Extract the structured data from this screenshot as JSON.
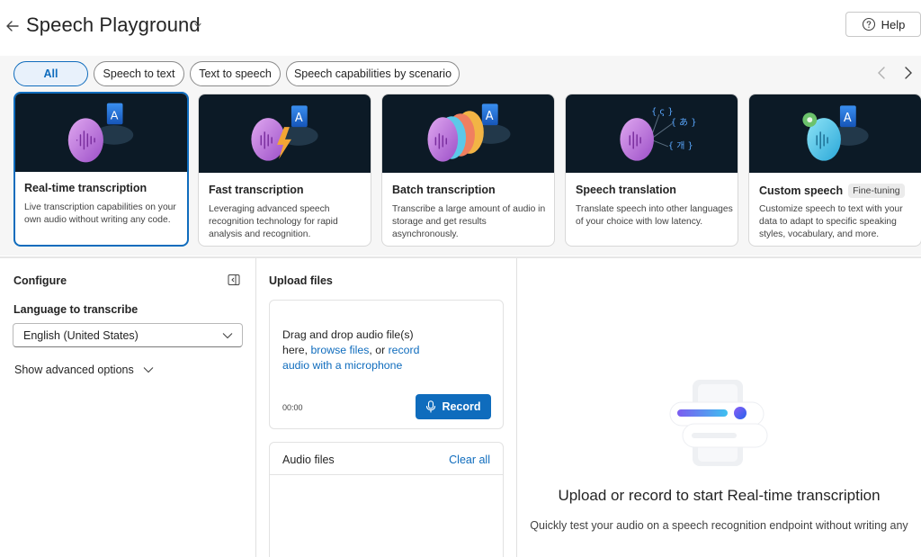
{
  "header": {
    "title": "Speech Playground",
    "help_label": "Help"
  },
  "filters": {
    "items": [
      {
        "label": "All",
        "active": true
      },
      {
        "label": "Speech to text",
        "active": false
      },
      {
        "label": "Text to speech",
        "active": false
      },
      {
        "label": "Speech capabilities by scenario",
        "active": false
      }
    ]
  },
  "cards": [
    {
      "title": "Real-time transcription",
      "desc": "Live transcription capabilities on your own audio without writing any code.",
      "selected": true
    },
    {
      "title": "Fast transcription",
      "desc": "Leveraging advanced speech recognition technology for rapid analysis and recognition.",
      "selected": false
    },
    {
      "title": "Batch transcription",
      "desc": "Transcribe a large amount of audio in storage and get results asynchronously.",
      "selected": false
    },
    {
      "title": "Speech translation",
      "desc": "Translate speech into other languages of your choice with low latency.",
      "selected": false
    },
    {
      "title": "Custom speech",
      "badge": "Fine-tuning",
      "desc": "Customize speech to text with your data to adapt to specific speaking styles, vocabulary, and more.",
      "selected": false
    }
  ],
  "configure": {
    "heading": "Configure",
    "language_label": "Language to transcribe",
    "language_value": "English (United States)",
    "advanced_label": "Show advanced options"
  },
  "upload": {
    "heading": "Upload files",
    "drop_prefix": "Drag and drop audio file(s) here, ",
    "browse_link": "browse files",
    "drop_middle": ", or ",
    "record_link": "record audio with a microphone",
    "timer": "00:00",
    "record_label": "Record",
    "audio_files_label": "Audio files",
    "clear_all_label": "Clear all"
  },
  "result": {
    "title": "Upload or record to start Real-time transcription",
    "subtitle": "Quickly test your audio on a speech recognition endpoint without writing any"
  },
  "colors": {
    "accent": "#0f6cbd",
    "card_art_bg": "#0c1a26"
  }
}
